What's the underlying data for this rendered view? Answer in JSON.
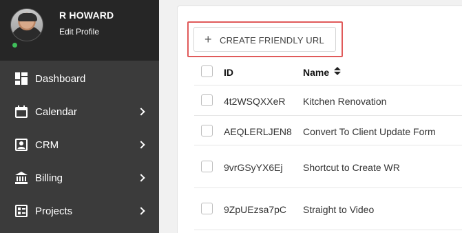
{
  "user": {
    "name": "R HOWARD",
    "edit_label": "Edit Profile",
    "status_color": "#3fbf5a"
  },
  "nav": [
    {
      "label": "Dashboard",
      "icon": "dashboard-icon",
      "has_submenu": false
    },
    {
      "label": "Calendar",
      "icon": "calendar-icon",
      "has_submenu": true
    },
    {
      "label": "CRM",
      "icon": "contact-card-icon",
      "has_submenu": true
    },
    {
      "label": "Billing",
      "icon": "bank-icon",
      "has_submenu": true
    },
    {
      "label": "Projects",
      "icon": "projects-list-icon",
      "has_submenu": true
    }
  ],
  "toolbar": {
    "create_label": "CREATE FRIENDLY URL",
    "create_icon": "plus-icon",
    "highlight_color": "#e05a5a"
  },
  "table": {
    "columns": [
      "ID",
      "Name"
    ],
    "rows": [
      {
        "id": "4t2WSQXXeR",
        "name": "Kitchen Renovation"
      },
      {
        "id": "AEQLERLJEN8",
        "name": "Convert To Client Update Form"
      },
      {
        "id": "9vrGSyYX6Ej",
        "name": "Shortcut to Create WR"
      },
      {
        "id": "9ZpUEzsa7pC",
        "name": "Straight to Video"
      }
    ]
  },
  "colors": {
    "sidebar": "#3b3b3b",
    "profile_bg": "#262626",
    "main_bg": "#f1f1f1"
  }
}
